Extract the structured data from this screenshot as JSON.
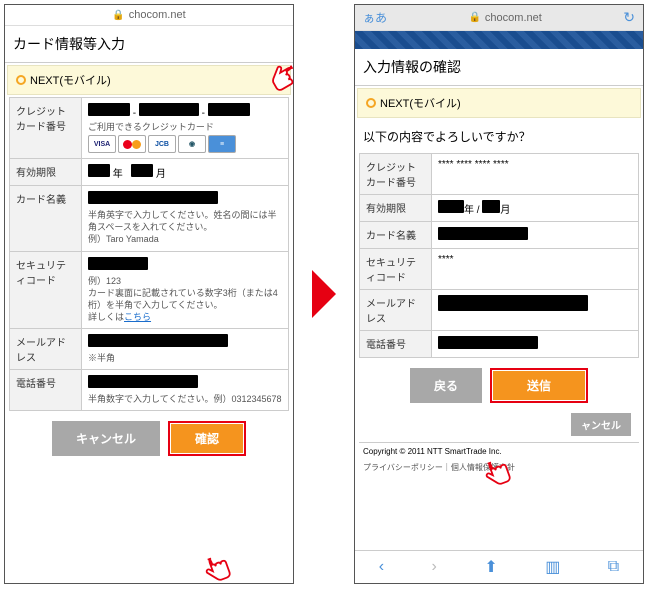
{
  "url": "chocom.net",
  "left": {
    "title": "カード情報等入力",
    "next": "NEXT(モバイル)",
    "labels": {
      "card_no": "クレジットカード番号",
      "card_hint": "ご利用できるクレジットカード",
      "expiry": "有効期限",
      "year": "年",
      "month": "月",
      "name": "カード名義",
      "name_hint": "半角英字で入力してください。姓名の間には半角スペースを入れてください。\n例）Taro Yamada",
      "cvv": "セキュリティコード",
      "cvv_hint": "例）123\nカード裏面に記載されている数字3桁（または4桁）を半角で入力してください。\n詳しくは",
      "cvv_link": "こちら",
      "email": "メールアドレス",
      "email_hint": "※半角",
      "phone": "電話番号",
      "phone_hint": "半角数字で入力してください。例）0312345678"
    },
    "btn_cancel": "キャンセル",
    "btn_confirm": "確認"
  },
  "right": {
    "aa": "ぁあ",
    "title": "入力情報の確認",
    "next": "NEXT(モバイル)",
    "question": "以下の内容でよろしいですか？",
    "labels": {
      "card_no": "クレジットカード番号",
      "card_mask": "**** **** **** ****",
      "expiry": "有効期限",
      "year": "年 /",
      "month": "月",
      "name": "カード名義",
      "cvv": "セキュリティコード",
      "cvv_mask": "****",
      "email": "メールアドレス",
      "phone": "電話番号"
    },
    "btn_back": "戻る",
    "btn_send": "送信",
    "btn_cancel": "ャンセル",
    "copyright": "Copyright © 2011 NTT SmartTrade Inc.",
    "privacy": "プライバシーポリシー｜個人情報保護方針"
  }
}
